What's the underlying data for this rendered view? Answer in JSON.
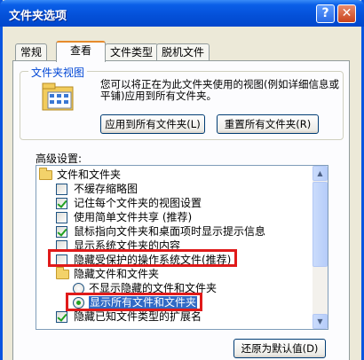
{
  "window": {
    "title": "文件夹选项",
    "help_glyph": "?",
    "close_glyph": "✕"
  },
  "tabs": [
    {
      "label": "常规",
      "active": false
    },
    {
      "label": "查看",
      "active": true
    },
    {
      "label": "文件类型",
      "active": false
    },
    {
      "label": "脱机文件",
      "active": false
    }
  ],
  "folder_view": {
    "group_title": "文件夹视图",
    "description": "您可以将正在为此文件夹使用的视图(例如详细信息或平铺)应用到所有文件夹。",
    "apply_all_label": "应用到所有文件夹(L)",
    "reset_all_label": "重置所有文件夹(R)"
  },
  "advanced": {
    "label": "高级设置:",
    "items": [
      {
        "type": "folder",
        "label": "文件和文件夹"
      },
      {
        "type": "checkbox",
        "label": "不缓存缩略图",
        "checked": false
      },
      {
        "type": "checkbox",
        "label": "记住每个文件夹的视图设置",
        "checked": true
      },
      {
        "type": "checkbox",
        "label": "使用简单文件共享 (推荐)",
        "checked": false
      },
      {
        "type": "checkbox",
        "label": "鼠标指向文件夹和桌面项时显示提示信息",
        "checked": true
      },
      {
        "type": "checkbox",
        "label": "显示系统文件夹的内容",
        "checked": false
      },
      {
        "type": "checkbox",
        "label": "隐藏受保护的操作系统文件(推荐)",
        "checked": false
      },
      {
        "type": "folder",
        "label": "隐藏文件和文件夹"
      },
      {
        "type": "radio",
        "label": "不显示隐藏的文件和文件夹",
        "selected": false
      },
      {
        "type": "radio",
        "label": "显示所有文件和文件夹",
        "selected": true
      },
      {
        "type": "checkbox",
        "label": "隐藏已知文件类型的扩展名",
        "checked": true
      }
    ]
  },
  "restore_defaults_label": "还原为默认值(D)",
  "colors": {
    "titlebar": "#0450d8",
    "highlight": "#e01a1a",
    "selection": "#316ac5"
  }
}
